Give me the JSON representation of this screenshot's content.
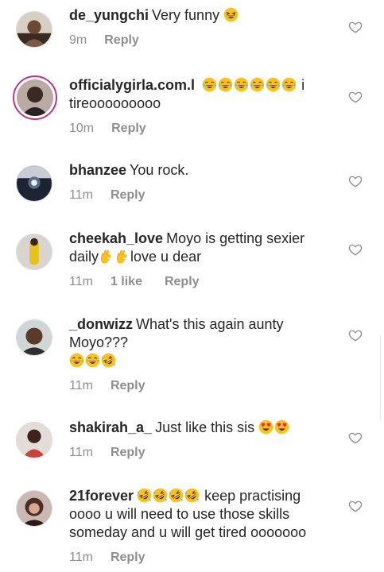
{
  "comments": [
    {
      "username": "de_yungchi",
      "text": "Very funny",
      "time": "9m",
      "reply": "Reply"
    },
    {
      "username": "officialygirla.com.l",
      "text": "i tireooooooooo",
      "time": "10m",
      "reply": "Reply"
    },
    {
      "username": "bhanzee",
      "text": "You rock.",
      "time": "11m",
      "reply": "Reply"
    },
    {
      "username": "cheekah_love",
      "text": "Moyo is getting sexier daily",
      "text2": "love u dear",
      "time": "11m",
      "likes": "1 like",
      "reply": "Reply"
    },
    {
      "username": "_donwizz",
      "text": "What's this again aunty Moyo???",
      "time": "11m",
      "reply": "Reply"
    },
    {
      "username": "shakirah_a_",
      "text": "Just like this sis",
      "time": "11m",
      "reply": "Reply"
    },
    {
      "username": "21forever",
      "text": "keep practising oooo u will need to use those skills someday and u will get tired ooooooo",
      "time": "11m",
      "reply": "Reply"
    }
  ],
  "icons": {
    "like": "heart-outline-icon",
    "emoji_laugh": "grinning-squinting-face-icon",
    "emoji_tears": "face-with-tears-of-joy-icon",
    "emoji_rofl": "rolling-on-floor-laughing-icon",
    "emoji_ok": "ok-hand-icon",
    "emoji_hearteyes": "smiling-face-with-heart-eyes-icon"
  },
  "colors": {
    "text": "#262626",
    "meta": "#8e8e8e",
    "story_ring": "#c13584"
  }
}
